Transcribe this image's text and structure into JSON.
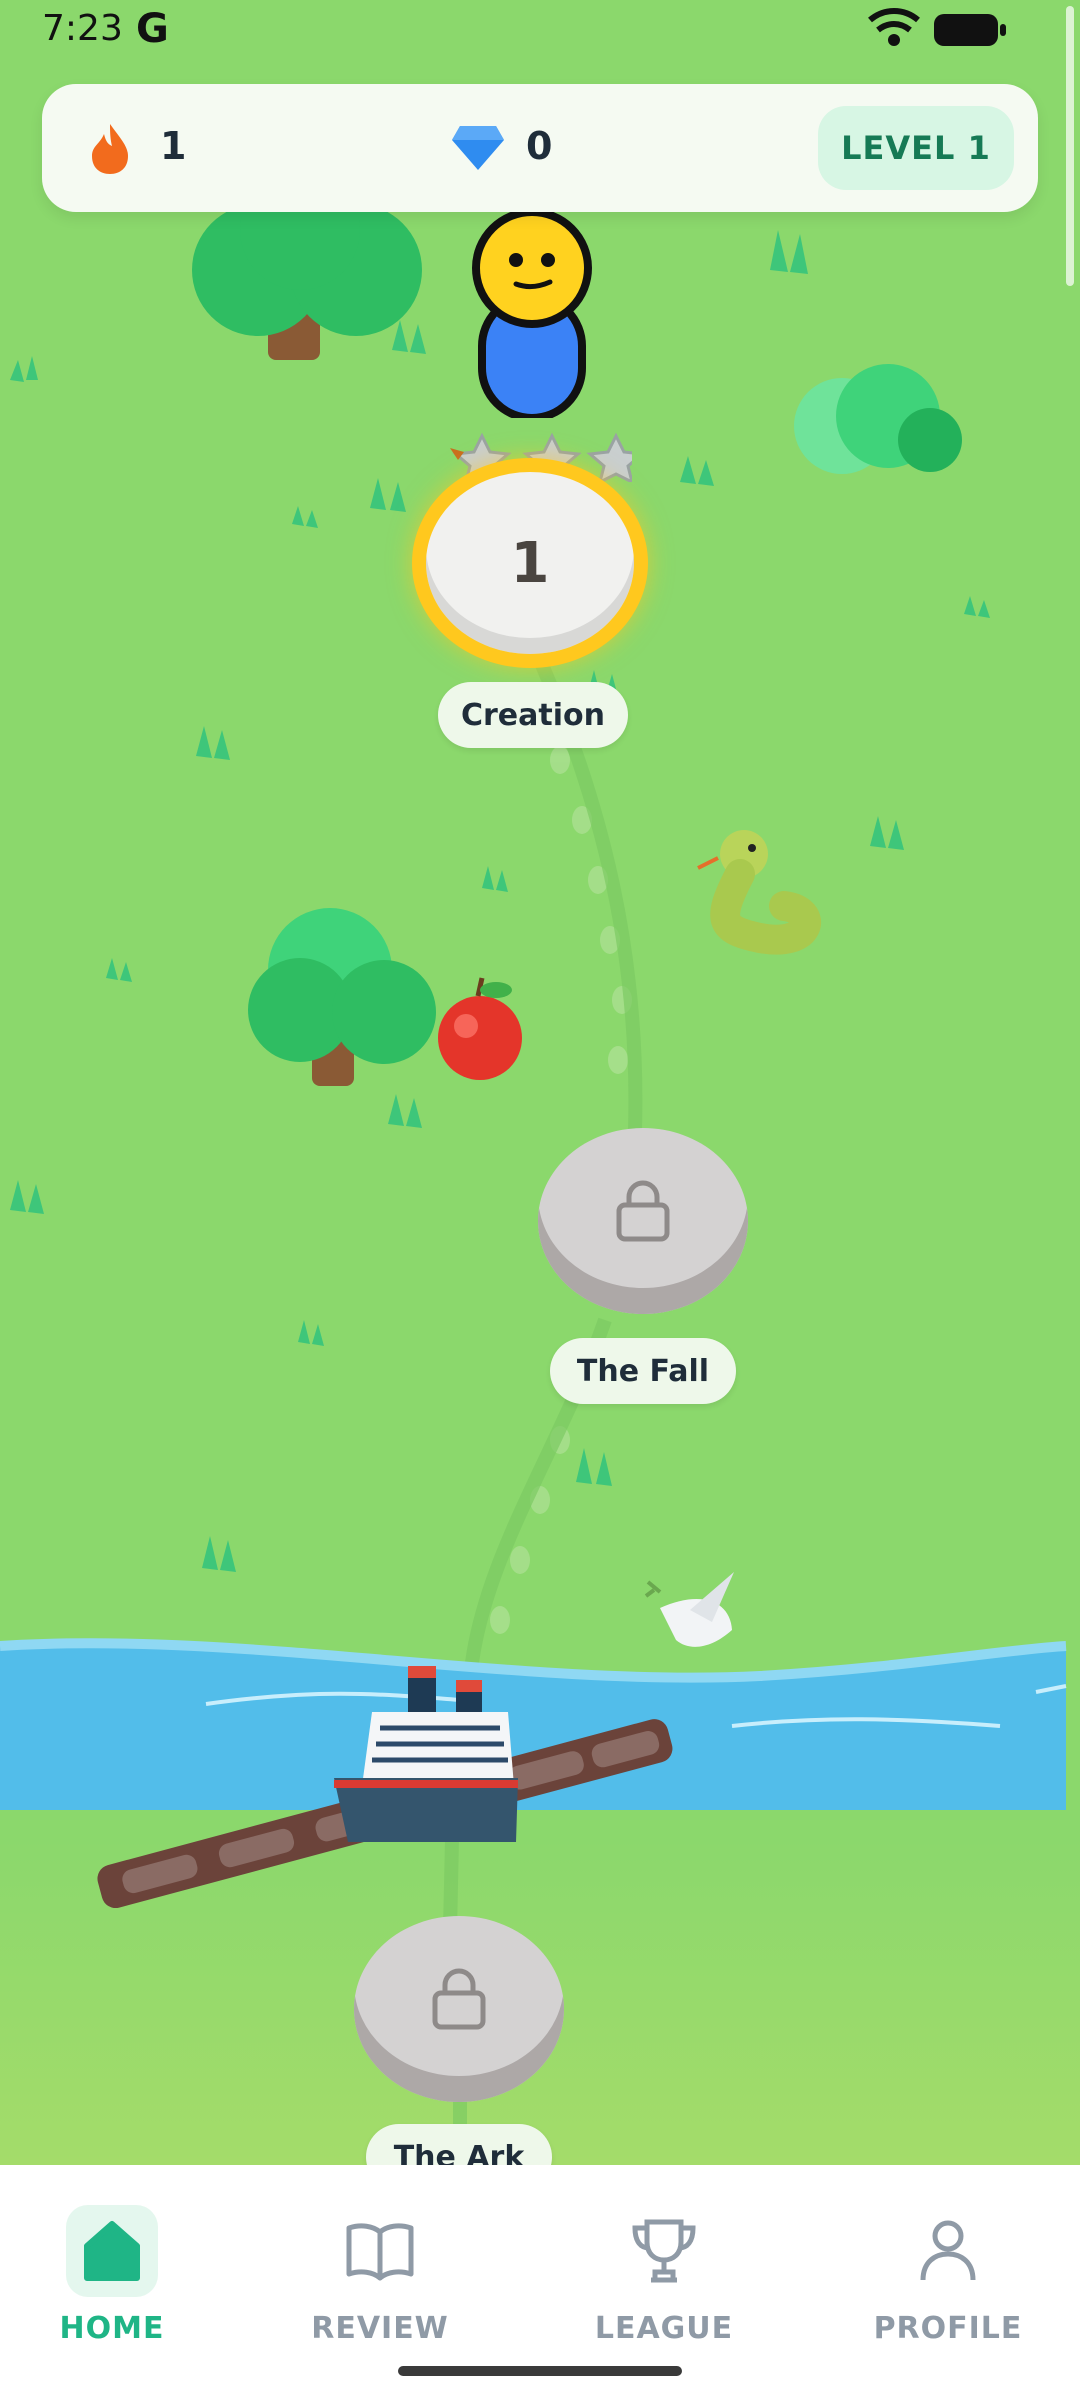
{
  "status_bar": {
    "time": "7:23",
    "carrier_glyph": "G"
  },
  "header": {
    "streak_count": "1",
    "gems_count": "0",
    "level_label": "LEVEL 1"
  },
  "path": {
    "nodes": [
      {
        "number": "1",
        "title": "Creation",
        "state": "current",
        "stars_total": 3
      },
      {
        "title": "The Fall",
        "state": "locked"
      },
      {
        "title": "The Ark",
        "state": "locked"
      }
    ]
  },
  "bottom_nav": {
    "items": [
      {
        "label": "HOME",
        "icon": "home-icon",
        "active": true
      },
      {
        "label": "REVIEW",
        "icon": "book-icon",
        "active": false
      },
      {
        "label": "LEAGUE",
        "icon": "trophy-icon",
        "active": false
      },
      {
        "label": "PROFILE",
        "icon": "person-icon",
        "active": false
      }
    ]
  },
  "colors": {
    "grass": "#8bd86c",
    "accent": "#1fb586",
    "inactive_nav": "#8f9aa6",
    "water": "#52bdea",
    "node_highlight": "#ffc81e"
  }
}
